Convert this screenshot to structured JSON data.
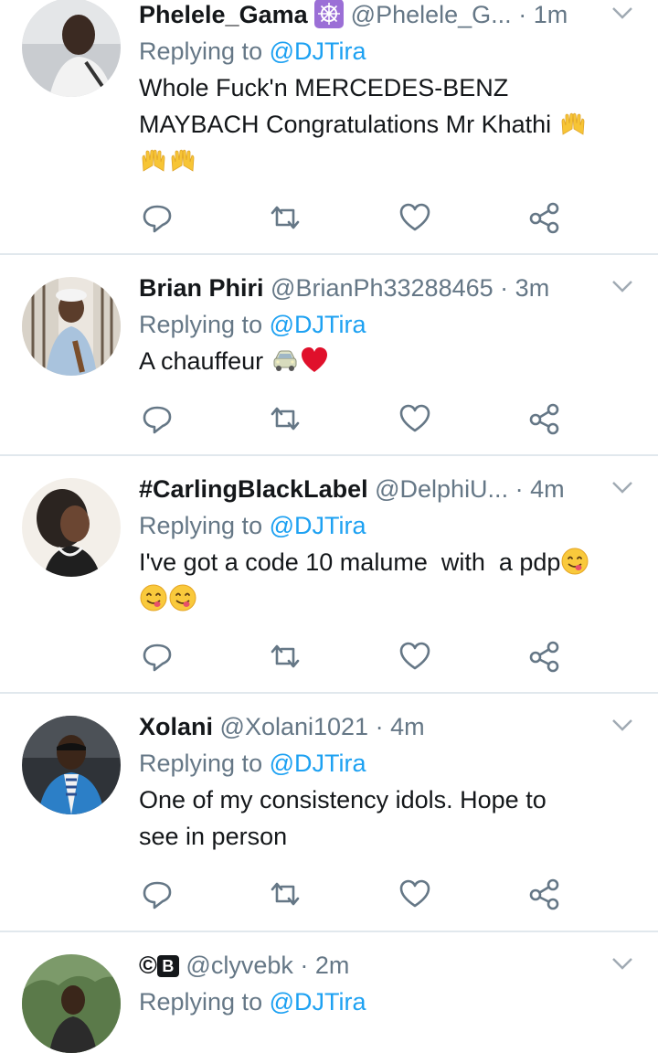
{
  "colors": {
    "link": "#1da1f2",
    "muted": "#657786",
    "divider": "#e1e8ed",
    "text": "#14171a"
  },
  "tweets": [
    {
      "name": "Phelele_Gama",
      "name_badge_icon": "dharma-wheel-emoji",
      "handle": "@Phelele_G...",
      "dot": "·",
      "time": "1m",
      "reply_prefix": "Replying to",
      "reply_to": "@DJTira",
      "lines": [
        "Whole Fuck'n MERCEDES-BENZ",
        "MAYBACH Congratulations Mr Khathi"
      ],
      "emojis": [
        "raising-hands-emoji",
        "raising-hands-emoji",
        "raising-hands-emoji"
      ]
    },
    {
      "name": "Brian Phiri",
      "handle": "@BrianPh33288465",
      "dot": "·",
      "time": "3m",
      "reply_prefix": "Replying to",
      "reply_to": "@DJTira",
      "lines": [
        "A chauffeur"
      ],
      "emojis": [
        "car-emoji",
        "red-heart-emoji"
      ]
    },
    {
      "name": "#CarlingBlackLabel",
      "handle": "@DelphiU...",
      "dot": "·",
      "time": "4m",
      "reply_prefix": "Replying to",
      "reply_to": "@DJTira",
      "lines": [
        "I've got a code 10 malume  with  a pdp"
      ],
      "emojis": [
        "yum-face-emoji",
        "yum-face-emoji",
        "yum-face-emoji"
      ]
    },
    {
      "name": "Xolani",
      "handle": "@Xolani1021",
      "dot": "·",
      "time": "4m",
      "reply_prefix": "Replying to",
      "reply_to": "@DJTira",
      "lines": [
        "One of my consistency idols. Hope to",
        "see in person"
      ],
      "emojis": []
    },
    {
      "name": "©",
      "name_badge": "B",
      "handle": "@clyvebk",
      "dot": "·",
      "time": "2m",
      "reply_prefix": "Replying to",
      "reply_to": "@DJTira",
      "lines": [],
      "emojis": []
    }
  ],
  "action_icons": [
    "reply-icon",
    "retweet-icon",
    "like-icon",
    "share-icon"
  ]
}
